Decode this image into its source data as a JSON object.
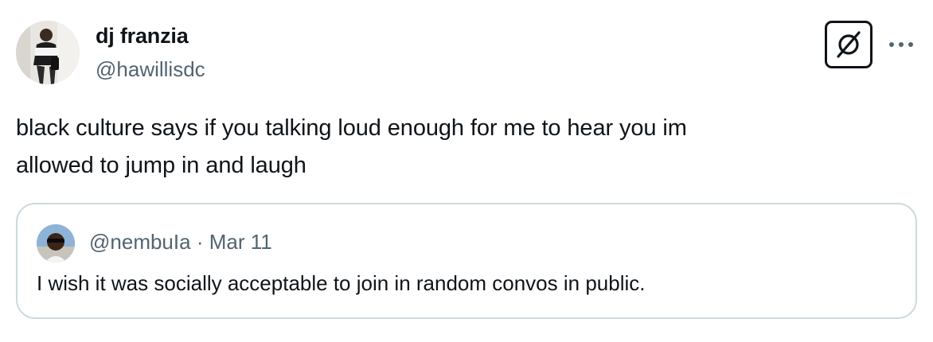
{
  "author": {
    "display_name": "dj franzia",
    "handle": "@hawillisdc",
    "avatar_icon": "profile-photo"
  },
  "header_actions": {
    "grok_icon": "grok-icon",
    "more_icon": "more-horizontal-icon"
  },
  "tweet": {
    "text_line1": "black culture says if you talking loud enough for me to hear you im",
    "text_line2": "allowed to jump in and laugh"
  },
  "quote": {
    "handle": "@nembuIa",
    "separator": "·",
    "date": "Mar 11",
    "text": "I wish it was socially acceptable to join in random convos in public.",
    "avatar_icon": "profile-photo"
  },
  "colors": {
    "text_primary": "#0f1419",
    "text_secondary": "#536471",
    "border": "#cfd9de",
    "background": "#ffffff"
  }
}
